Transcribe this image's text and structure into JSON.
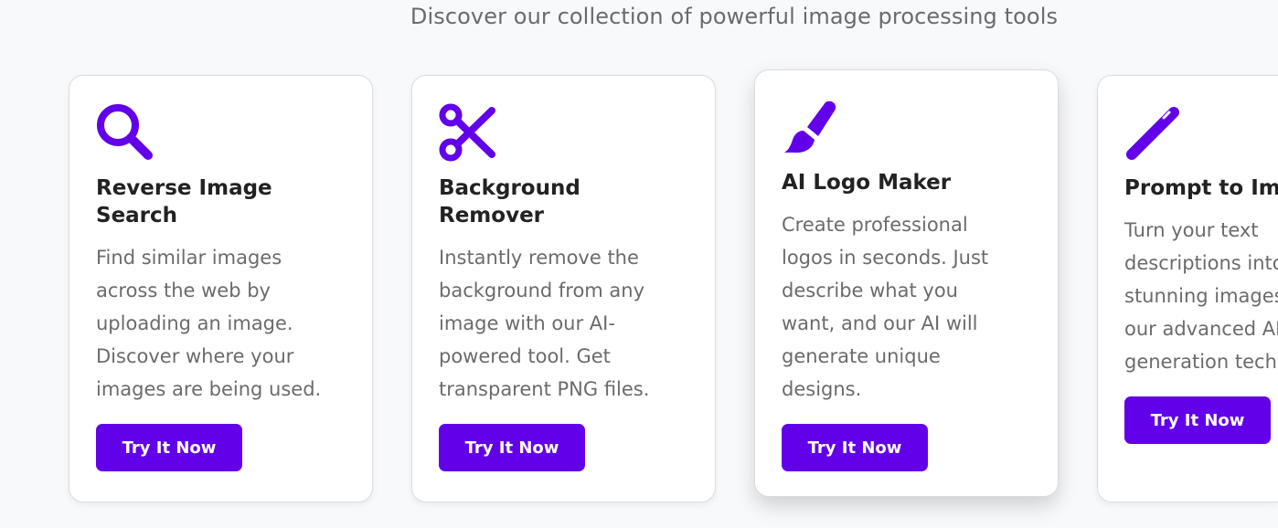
{
  "header": {
    "subtitle": "Discover our collection of powerful image processing tools"
  },
  "accent_color": "#6200ea",
  "cards": [
    {
      "icon": "search-icon",
      "title_lines": [
        "Reverse Image",
        "Search"
      ],
      "description_lines": [
        "Find similar images",
        "across the web by",
        "uploading an image.",
        "Discover where your",
        "images are being used."
      ],
      "button_label": "Try It Now"
    },
    {
      "icon": "scissors-icon",
      "title_lines": [
        "Background",
        "Remover"
      ],
      "description_lines": [
        "Instantly remove the",
        "background from any",
        "image with our AI-",
        "powered tool. Get",
        "transparent PNG files."
      ],
      "button_label": "Try It Now"
    },
    {
      "icon": "paintbrush-icon",
      "title_lines": [
        "AI Logo Maker"
      ],
      "description_lines": [
        "Create professional",
        "logos in seconds. Just",
        "describe what you",
        "want, and our AI will",
        "generate unique",
        "designs."
      ],
      "button_label": "Try It Now"
    },
    {
      "icon": "magic-wand-icon",
      "title_lines": [
        "Prompt to Image"
      ],
      "description_lines": [
        "Turn your text",
        "descriptions into",
        "stunning images with",
        "our advanced AI",
        "generation technology."
      ],
      "button_label": "Try It Now"
    }
  ]
}
